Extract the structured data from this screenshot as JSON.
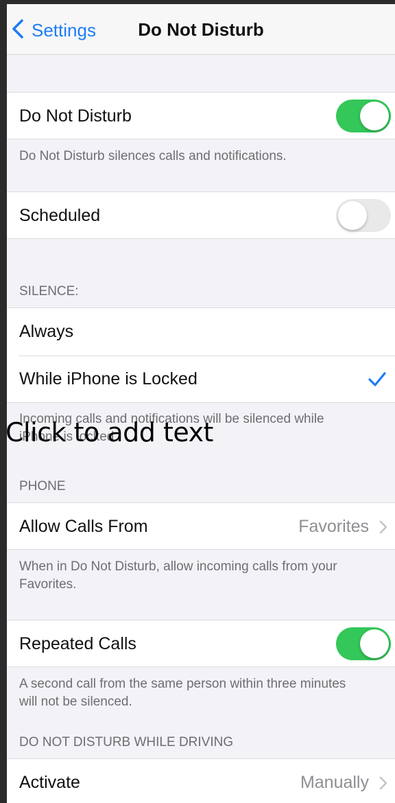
{
  "nav": {
    "back_label": "Settings",
    "title": "Do Not Disturb"
  },
  "dnd": {
    "label": "Do Not Disturb",
    "on": true,
    "footer": "Do Not Disturb silences calls and notifications."
  },
  "scheduled": {
    "label": "Scheduled",
    "on": false
  },
  "silence": {
    "header": "SILENCE:",
    "options": [
      "Always",
      "While iPhone is Locked"
    ],
    "selected": "While iPhone is Locked",
    "footer_line1": "Incoming calls and notifications will be silenced while",
    "footer_line2": "iPhone is locked."
  },
  "overlay": {
    "text": "Click to add text"
  },
  "phone": {
    "header": "PHONE",
    "allow_calls_label": "Allow Calls From",
    "allow_calls_value": "Favorites",
    "footer": "When in Do Not Disturb, allow incoming calls from your Favorites."
  },
  "repeated": {
    "label": "Repeated Calls",
    "on": true,
    "footer": "A second call from the same person within three minutes will not be silenced."
  },
  "driving": {
    "header": "DO NOT DISTURB WHILE DRIVING",
    "activate_label": "Activate",
    "activate_value": "Manually"
  },
  "colors": {
    "accent": "#1f7cf5",
    "toggle_on": "#34c759",
    "toggle_off": "#e9e9ea",
    "grouped_bg": "#f2f2f7",
    "secondary_text": "#6d6d72"
  }
}
